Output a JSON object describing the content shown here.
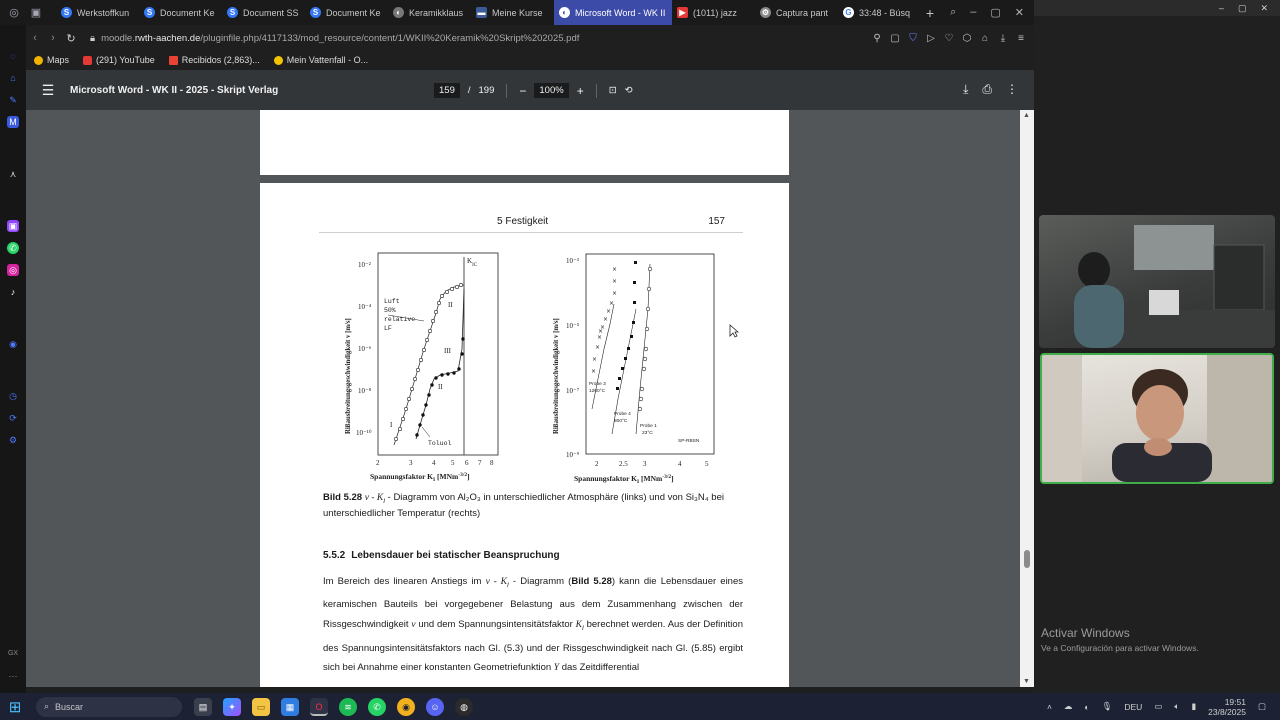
{
  "browser": {
    "tabs": [
      {
        "label": "Werkstoffkun",
        "color": "#3478f6",
        "glyph": "S",
        "active": false
      },
      {
        "label": "Document Ke",
        "color": "#3478f6",
        "glyph": "S",
        "active": false
      },
      {
        "label": "Document SS",
        "color": "#3478f6",
        "glyph": "S",
        "active": false
      },
      {
        "label": "Document Ke",
        "color": "#3478f6",
        "glyph": "S",
        "active": false
      },
      {
        "label": "Keramikklaus",
        "color": "#777777",
        "glyph": "◐",
        "active": false
      },
      {
        "label": "Meine Kurse",
        "color": "#3d5a9a",
        "glyph": "▬",
        "active": false
      },
      {
        "label": "Microsoft Word - WK II",
        "color": "#ffffff",
        "glyph": "◐",
        "active": true
      },
      {
        "label": "(1011) jazz",
        "color": "#e53935",
        "glyph": "▶",
        "active": false
      },
      {
        "label": "Captura pant",
        "color": "#888888",
        "glyph": "⚙",
        "active": false
      },
      {
        "label": "33:48 - Búsq",
        "color": "#ffffff",
        "glyph": "G",
        "active": false
      }
    ],
    "url_prefix": "moodle.",
    "url_domain": "rwth-aachen.de",
    "url_path": "/pluginfile.php/4117133/mod_resource/content/1/WKII%20Keramik%20Skript%202025.pdf",
    "bookmarks": [
      {
        "label": "Maps",
        "color": "#f0b400"
      },
      {
        "label": "(291) YouTube",
        "color": "#e53935"
      },
      {
        "label": "Recibidos (2,863)...",
        "color": "#ea4335"
      },
      {
        "label": "Mein Vattenfall - O...",
        "color": "#f4c400"
      }
    ]
  },
  "pdf": {
    "title": "Microsoft Word - WK II - 2025 - Skript Verlag",
    "current_page": "159",
    "page_separator": "/",
    "total_pages": "199",
    "zoom": "100%",
    "running_head": "5 Festigkeit",
    "page_number": "157",
    "figure": {
      "left": {
        "ylabel": "Rißausbreitungsgeschwindigkeit v [m/s]",
        "xlabel": "Spannungsfaktor K",
        "xlabel_sub": "I",
        "xlabel_unit": " [MNm",
        "xlabel_exp": "-3/2",
        "xlabel_close": "]",
        "yticks": [
          "10⁻²",
          "10⁻⁴",
          "10⁻⁶",
          "10⁻⁸",
          "10⁻¹⁰"
        ],
        "xticks": [
          "2",
          "3",
          "4",
          "5",
          "6",
          "7",
          "8"
        ],
        "annotations": [
          "Luft",
          "50%",
          "relative",
          "LF",
          "Toluol",
          "I",
          "II",
          "III",
          "II",
          "K",
          "IC"
        ]
      },
      "right": {
        "ylabel": "Rißausbreitungsgeschwindigkeit v [m/s]",
        "xlabel": "Spannungsfaktor K",
        "xlabel_sub": "I",
        "xlabel_unit": " [MNm",
        "xlabel_exp": "-3/2",
        "xlabel_close": "]",
        "yticks": [
          "10⁻³",
          "10⁻⁵",
          "10⁻⁷",
          "10⁻⁹"
        ],
        "xticks": [
          "2",
          "2.5",
          "3",
          "4",
          "5"
        ],
        "annotations": [
          "Probe 3",
          "1200°C",
          "Probe 4",
          "800°C",
          "Probe 1",
          "23°C",
          "SP-RBSN"
        ]
      }
    },
    "caption_label": "Bild 5.28",
    "caption_expr": "v - K",
    "caption_sub": "I",
    "caption_text": " - Diagramm von Al₂O₃ in unterschiedlicher Atmosphäre (links) und von Si₃N₄ bei unterschiedlicher Temperatur (rechts)",
    "section_number": "5.5.2",
    "section_title": "Lebensdauer bei statischer Beanspruchung",
    "body": {
      "p1_a": "Im Bereich des linearen Anstiegs im ",
      "p1_expr": "v - K",
      "p1_sub": "I",
      "p1_b": " - Diagramm (",
      "p1_ref": "Bild 5.28",
      "p1_c": ") kann die Lebensdauer eines keramischen Bauteils bei vorgegebener Belastung aus dem Zusammenhang zwischen der Rissgeschwindigkeit ",
      "p1_v": "v",
      "p1_d": " und dem Spannungsintensitätsfaktor ",
      "p1_k": "K",
      "p1_ksub": "I",
      "p1_e": " berechnet werden. Aus der Definition des Spannungsintensitätsfaktors nach Gl. (5.3) und der Rissgeschwindigkeit nach Gl. (5.85) ergibt sich bei Annahme einer konstanten Geometriefunktion ",
      "p1_y": "Y",
      "p1_f": " das Zeitdifferential"
    }
  },
  "windows": {
    "activate_title": "Activar Windows",
    "activate_sub": "Ve a Configuración para activar Windows.",
    "search_placeholder": "Buscar",
    "language": "DEU",
    "time": "19:51",
    "date": "23/8/2025"
  },
  "colors": {
    "active_tab": "#3c4ba8",
    "pdf_toolbar": "#323639",
    "pdf_bg": "#525659",
    "camera_highlight": "#3fae49"
  }
}
